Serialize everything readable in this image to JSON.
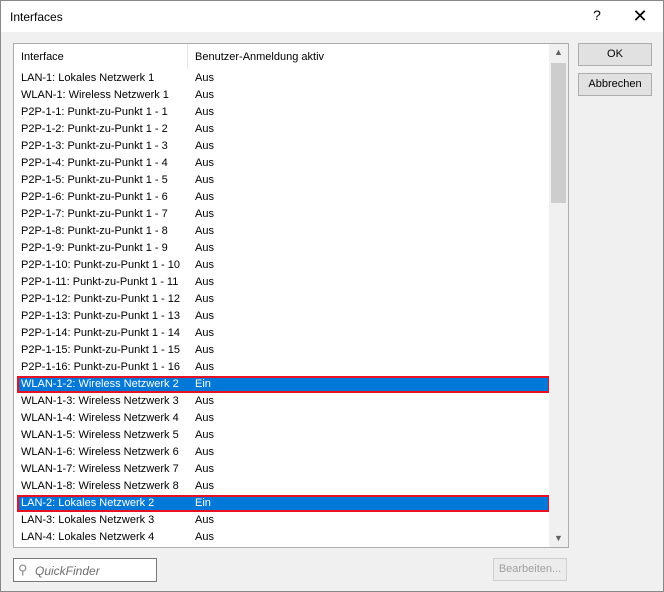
{
  "window": {
    "title": "Interfaces",
    "help_label": "?",
    "close_label": "✕"
  },
  "table": {
    "columns": [
      "Interface",
      "Benutzer-Anmeldung aktiv"
    ],
    "rows": [
      [
        "LAN-1: Lokales Netzwerk 1",
        "Aus"
      ],
      [
        "WLAN-1: Wireless Netzwerk 1",
        "Aus"
      ],
      [
        "P2P-1-1: Punkt-zu-Punkt 1 - 1",
        "Aus"
      ],
      [
        "P2P-1-2: Punkt-zu-Punkt 1 - 2",
        "Aus"
      ],
      [
        "P2P-1-3: Punkt-zu-Punkt 1 - 3",
        "Aus"
      ],
      [
        "P2P-1-4: Punkt-zu-Punkt 1 - 4",
        "Aus"
      ],
      [
        "P2P-1-5: Punkt-zu-Punkt 1 - 5",
        "Aus"
      ],
      [
        "P2P-1-6: Punkt-zu-Punkt 1 - 6",
        "Aus"
      ],
      [
        "P2P-1-7: Punkt-zu-Punkt 1 - 7",
        "Aus"
      ],
      [
        "P2P-1-8: Punkt-zu-Punkt 1 - 8",
        "Aus"
      ],
      [
        "P2P-1-9: Punkt-zu-Punkt 1 - 9",
        "Aus"
      ],
      [
        "P2P-1-10: Punkt-zu-Punkt 1 - 10",
        "Aus"
      ],
      [
        "P2P-1-11: Punkt-zu-Punkt 1 - 11",
        "Aus"
      ],
      [
        "P2P-1-12: Punkt-zu-Punkt 1 - 12",
        "Aus"
      ],
      [
        "P2P-1-13: Punkt-zu-Punkt 1 - 13",
        "Aus"
      ],
      [
        "P2P-1-14: Punkt-zu-Punkt 1 - 14",
        "Aus"
      ],
      [
        "P2P-1-15: Punkt-zu-Punkt 1 - 15",
        "Aus"
      ],
      [
        "P2P-1-16: Punkt-zu-Punkt 1 - 16",
        "Aus"
      ],
      [
        "WLAN-1-2: Wireless Netzwerk 2",
        "Ein"
      ],
      [
        "WLAN-1-3: Wireless Netzwerk 3",
        "Aus"
      ],
      [
        "WLAN-1-4: Wireless Netzwerk 4",
        "Aus"
      ],
      [
        "WLAN-1-5: Wireless Netzwerk 5",
        "Aus"
      ],
      [
        "WLAN-1-6: Wireless Netzwerk 6",
        "Aus"
      ],
      [
        "WLAN-1-7: Wireless Netzwerk 7",
        "Aus"
      ],
      [
        "WLAN-1-8: Wireless Netzwerk 8",
        "Aus"
      ],
      [
        "LAN-2: Lokales Netzwerk 2",
        "Ein"
      ],
      [
        "LAN-3: Lokales Netzwerk 3",
        "Aus"
      ],
      [
        "LAN-4: Lokales Netzwerk 4",
        "Aus"
      ]
    ],
    "selected_rows": [
      18,
      25
    ],
    "highlight_color": "#e81123",
    "selection_color": "#0078d7"
  },
  "buttons": {
    "ok": "OK",
    "cancel": "Abbrechen",
    "edit": "Bearbeiten..."
  },
  "quickfinder": {
    "placeholder": "QuickFinder",
    "icon": "magnifier-icon"
  }
}
